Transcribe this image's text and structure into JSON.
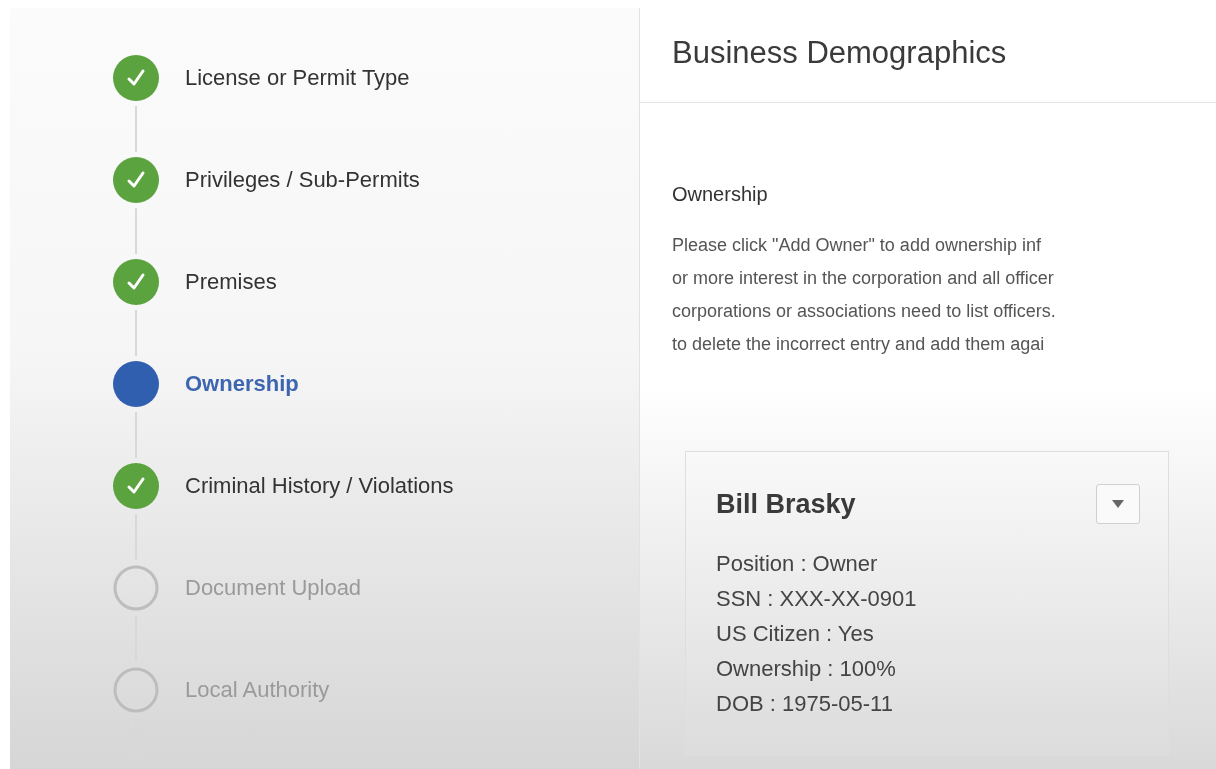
{
  "steps": [
    {
      "label": "License or Permit Type",
      "completed": true,
      "selected": false
    },
    {
      "label": "Privileges / Sub-Permits",
      "completed": true,
      "selected": false
    },
    {
      "label": "Premises",
      "completed": true,
      "selected": false
    },
    {
      "label": "Ownership",
      "completed": false,
      "selected": true
    },
    {
      "label": "Criminal History / Violations",
      "completed": true,
      "selected": false
    },
    {
      "label": "Document Upload",
      "completed": false,
      "selected": false
    },
    {
      "label": "Local Authority",
      "completed": false,
      "selected": false
    }
  ],
  "page": {
    "title": "Business Demographics",
    "section_title": "Ownership",
    "instructions": [
      "Please click \"Add Owner\" to add ownership inf",
      "or more interest in the corporation and all officer",
      "corporations or associations need to list officers.",
      "to delete the incorrect entry and add them agai"
    ],
    "owners": [
      {
        "name": "Bill Brasky",
        "details": [
          "Position : Owner",
          "SSN : XXX-XX-0901",
          "US Citizen : Yes",
          "Ownership : 100%",
          "DOB : 1975-05-11"
        ]
      }
    ]
  }
}
